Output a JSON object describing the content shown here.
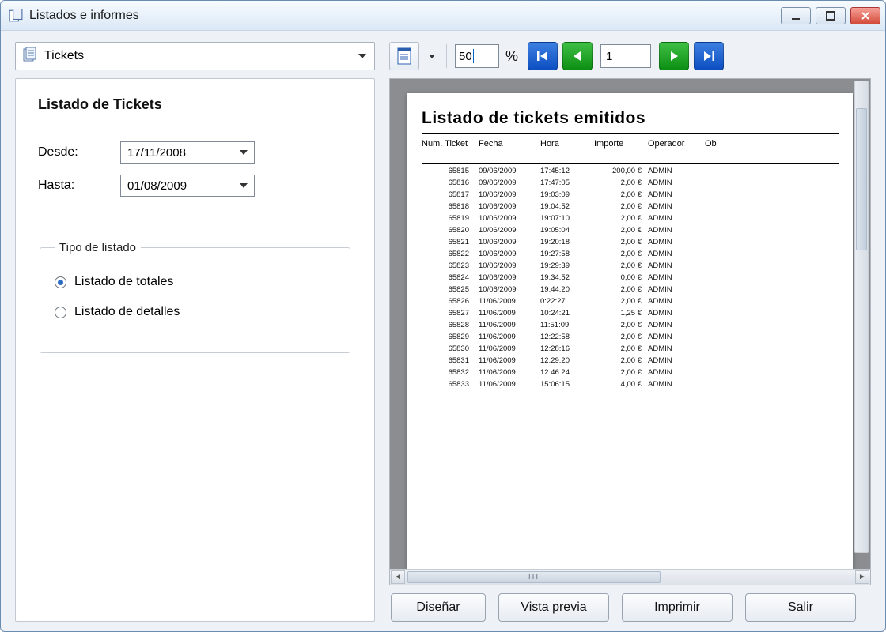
{
  "window": {
    "title": "Listados e informes"
  },
  "toolbar": {
    "report_selector": {
      "value": "Tickets"
    },
    "zoom": {
      "value": "50",
      "suffix": "%"
    },
    "page_number": "1"
  },
  "left": {
    "heading": "Listado de Tickets",
    "desde_label": "Desde:",
    "desde_value": "17/11/2008",
    "hasta_label": "Hasta:",
    "hasta_value": "01/08/2009",
    "tipo_legend": "Tipo de listado",
    "radio_totales": "Listado de totales",
    "radio_detalles": "Listado de detalles",
    "selected_tipo": "totales"
  },
  "report": {
    "title": "Listado de tickets emitidos",
    "columns": [
      "Num. Ticket",
      "Fecha",
      "Hora",
      "Importe",
      "Operador",
      "Ob"
    ],
    "rows": [
      [
        "65815",
        "09/06/2009",
        "17:45:12",
        "200,00 €",
        "ADMIN",
        ""
      ],
      [
        "65816",
        "09/06/2009",
        "17:47:05",
        "2,00 €",
        "ADMIN",
        ""
      ],
      [
        "65817",
        "10/06/2009",
        "19:03:09",
        "2,00 €",
        "ADMIN",
        ""
      ],
      [
        "65818",
        "10/06/2009",
        "19:04:52",
        "2,00 €",
        "ADMIN",
        ""
      ],
      [
        "65819",
        "10/06/2009",
        "19:07:10",
        "2,00 €",
        "ADMIN",
        ""
      ],
      [
        "65820",
        "10/06/2009",
        "19:05:04",
        "2,00 €",
        "ADMIN",
        ""
      ],
      [
        "65821",
        "10/06/2009",
        "19:20:18",
        "2,00 €",
        "ADMIN",
        ""
      ],
      [
        "65822",
        "10/06/2009",
        "19:27:58",
        "2,00 €",
        "ADMIN",
        ""
      ],
      [
        "65823",
        "10/06/2009",
        "19:29:39",
        "2,00 €",
        "ADMIN",
        ""
      ],
      [
        "65824",
        "10/06/2009",
        "19:34:52",
        "0,00 €",
        "ADMIN",
        ""
      ],
      [
        "65825",
        "10/06/2009",
        "19:44:20",
        "2,00 €",
        "ADMIN",
        ""
      ],
      [
        "65826",
        "11/06/2009",
        "0:22:27",
        "2,00 €",
        "ADMIN",
        ""
      ],
      [
        "65827",
        "11/06/2009",
        "10:24:21",
        "1,25 €",
        "ADMIN",
        ""
      ],
      [
        "65828",
        "11/06/2009",
        "11:51:09",
        "2,00 €",
        "ADMIN",
        ""
      ],
      [
        "65829",
        "11/06/2009",
        "12:22:58",
        "2,00 €",
        "ADMIN",
        ""
      ],
      [
        "65830",
        "11/06/2009",
        "12:28:16",
        "2,00 €",
        "ADMIN",
        ""
      ],
      [
        "65831",
        "11/06/2009",
        "12:29:20",
        "2,00 €",
        "ADMIN",
        ""
      ],
      [
        "65832",
        "11/06/2009",
        "12:46:24",
        "2,00 €",
        "ADMIN",
        ""
      ],
      [
        "65833",
        "11/06/2009",
        "15:06:15",
        "4,00 €",
        "ADMIN",
        ""
      ]
    ]
  },
  "buttons": {
    "design": "Diseñar",
    "preview": "Vista previa",
    "print": "Imprimir",
    "exit": "Salir"
  }
}
